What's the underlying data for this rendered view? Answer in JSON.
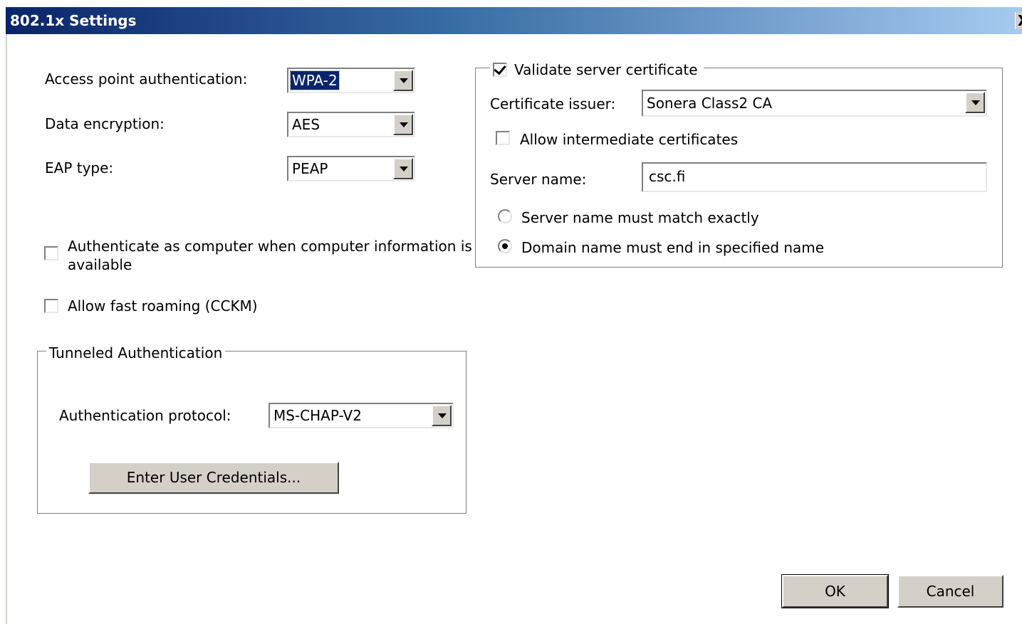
{
  "window": {
    "title": "802.1x Settings",
    "close_glyph": "X"
  },
  "left": {
    "access_point_auth": {
      "label": "Access point authentication:",
      "value": "WPA-2"
    },
    "data_encryption": {
      "label": "Data encryption:",
      "value": "AES"
    },
    "eap_type": {
      "label": "EAP type:",
      "value": "PEAP"
    },
    "auth_as_computer": {
      "label_line1": "Authenticate as computer when computer information is",
      "label_line2": "available",
      "checked": false
    },
    "fast_roaming": {
      "label": "Allow fast roaming (CCKM)",
      "checked": false
    }
  },
  "tunneled": {
    "legend": "Tunneled Authentication",
    "protocol": {
      "label": "Authentication protocol:",
      "value": "MS-CHAP-V2"
    },
    "credentials_button": "Enter User Credentials..."
  },
  "right": {
    "validate_cert": {
      "label": "Validate server certificate",
      "checked": true
    },
    "cert_issuer": {
      "label": "Certificate issuer:",
      "value": "Sonera Class2 CA"
    },
    "allow_intermediate": {
      "label": "Allow intermediate certificates",
      "checked": false
    },
    "server_name": {
      "label": "Server name:",
      "value": "csc.fi"
    },
    "match_exactly": {
      "label": "Server name must match exactly",
      "selected": false
    },
    "domain_end": {
      "label": "Domain name must end in specified name",
      "selected": true
    }
  },
  "footer": {
    "ok": "OK",
    "cancel": "Cancel"
  },
  "colors": {
    "titlebar_start": "#0a246a",
    "titlebar_end": "#a6caf0",
    "button_face": "#d4d0c8"
  }
}
